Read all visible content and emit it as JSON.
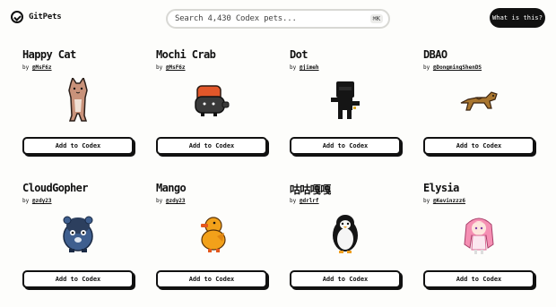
{
  "brand": {
    "name": "GitPets"
  },
  "search": {
    "placeholder": "Search 4,430 Codex pets...",
    "shortcut": "⌘K"
  },
  "header": {
    "what_is_label": "What is this?"
  },
  "cards": [
    {
      "name": "Happy Cat",
      "by": "by",
      "handle": "@MsF6z",
      "button": "Add to Codex",
      "icon": "cat-sprite-icon"
    },
    {
      "name": "Mochi Crab",
      "by": "by",
      "handle": "@MsF6z",
      "button": "Add to Codex",
      "icon": "crab-sprite-icon"
    },
    {
      "name": "Dot",
      "by": "by",
      "handle": "@jimeh",
      "button": "Add to Codex",
      "icon": "dot-sprite-icon"
    },
    {
      "name": "DBAO",
      "by": "by",
      "handle": "@DongmingShenDS",
      "button": "Add to Codex",
      "icon": "dbao-sprite-icon"
    },
    {
      "name": "CloudGopher",
      "by": "by",
      "handle": "@zdy23",
      "button": "Add to Codex",
      "icon": "gopher-sprite-icon"
    },
    {
      "name": "Mango",
      "by": "by",
      "handle": "@zdy23",
      "button": "Add to Codex",
      "icon": "duck-sprite-icon"
    },
    {
      "name": "咕咕嘎嘎",
      "by": "by",
      "handle": "@drlrf",
      "button": "Add to Codex",
      "icon": "penguin-sprite-icon"
    },
    {
      "name": "Elysia",
      "by": "by",
      "handle": "@Kevinzzz6",
      "button": "Add to Codex",
      "icon": "anime-girl-sprite-icon"
    }
  ]
}
